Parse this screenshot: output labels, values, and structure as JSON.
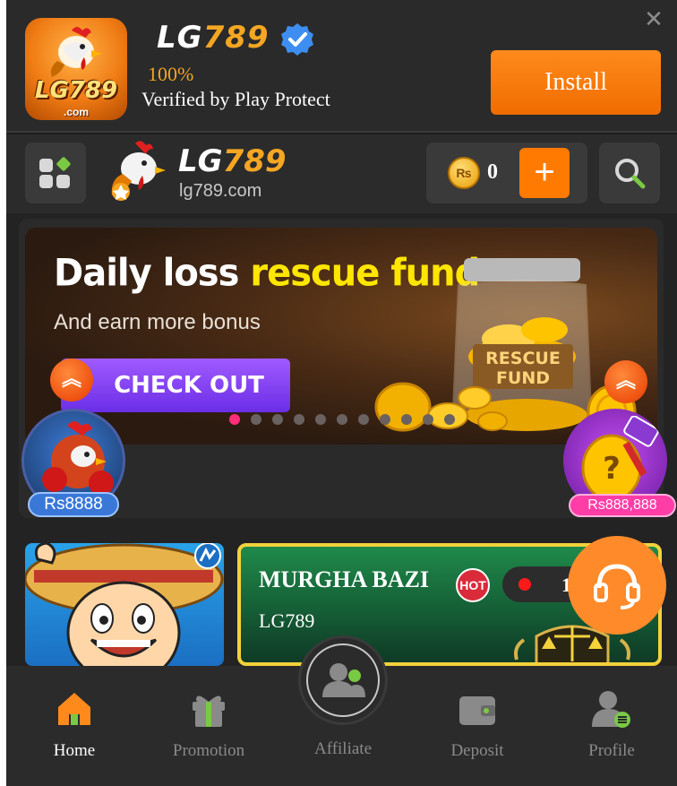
{
  "install_banner": {
    "app_name_part1": "LG",
    "app_name_part2": "789",
    "rating": "100%",
    "verified_text": "Verified by Play Protect",
    "install_label": "Install",
    "close_label": "✕",
    "icon_text": "LG789",
    "icon_sub": ".com"
  },
  "header": {
    "logo_part1": "LG",
    "logo_part2": "789",
    "domain": "lg789.com",
    "balance": "0",
    "currency_symbol": "₨",
    "add_label": "+"
  },
  "banner": {
    "title_part1": "Daily loss ",
    "title_part2": "rescue fund",
    "subtitle": "And earn more bonus",
    "cta_label": "CHECK OUT",
    "jar_label_line1": "RESCUE",
    "jar_label_line2": "FUND",
    "slide_count": 11,
    "active_slide": 1
  },
  "floating": {
    "left_amount": "Rs8888",
    "right_amount": "Rs888,888"
  },
  "games": {
    "murgha_title": "MURGHA BAZI",
    "murgha_sub": "LG789",
    "hot_label": "HOT",
    "live_count": "1"
  },
  "nav": {
    "items": [
      {
        "label": "Home",
        "icon": "home-icon",
        "active": true
      },
      {
        "label": "Promotion",
        "icon": "gift-icon",
        "active": false
      },
      {
        "label": "Affiliate",
        "icon": "users-icon",
        "active": false
      },
      {
        "label": "Deposit",
        "icon": "wallet-icon",
        "active": false
      },
      {
        "label": "Profile",
        "icon": "profile-icon",
        "active": false
      }
    ]
  },
  "colors": {
    "accent": "#ff7a00",
    "brand_gold": "#f5a623",
    "highlight_yellow": "#ffe600",
    "cta_purple": "#7a3ff0",
    "home_green": "#7ac943"
  }
}
